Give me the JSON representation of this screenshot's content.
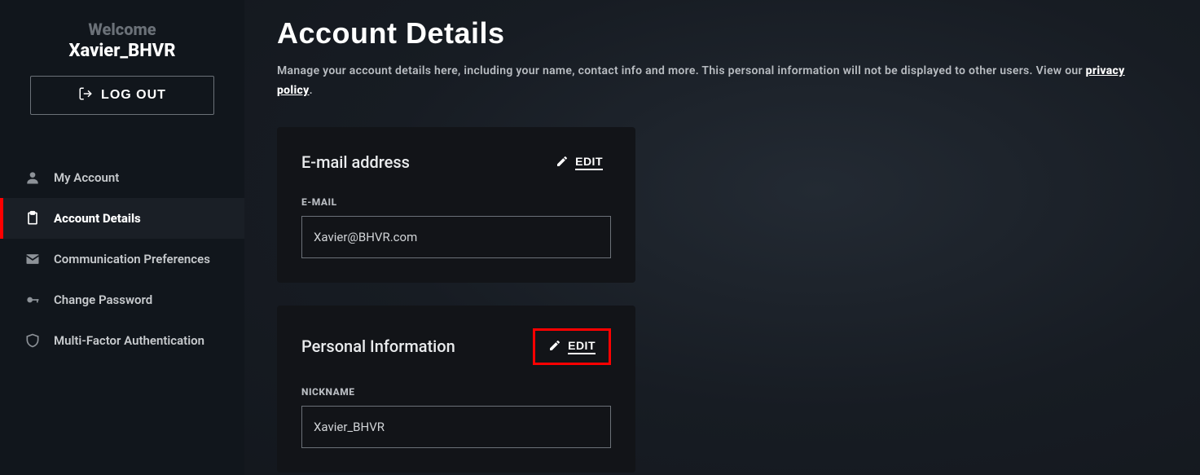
{
  "sidebar": {
    "welcome_label": "Welcome",
    "username": "Xavier_BHVR",
    "logout_label": "LOG OUT",
    "items": [
      {
        "label": "My Account"
      },
      {
        "label": "Account Details"
      },
      {
        "label": "Communication Preferences"
      },
      {
        "label": "Change Password"
      },
      {
        "label": "Multi-Factor Authentication"
      }
    ]
  },
  "page": {
    "title": "Account Details",
    "subtitle_prefix": "Manage your account details here, including your name, contact info and more. This personal information will not be displayed to other users. View our ",
    "privacy_link": "privacy policy",
    "subtitle_suffix": "."
  },
  "email_card": {
    "title": "E-mail address",
    "edit_label": "EDIT",
    "field_label": "E-MAIL",
    "field_value": "Xavier@BHVR.com"
  },
  "personal_card": {
    "title": "Personal Information",
    "edit_label": "EDIT",
    "field_label": "NICKNAME",
    "field_value": "Xavier_BHVR"
  }
}
